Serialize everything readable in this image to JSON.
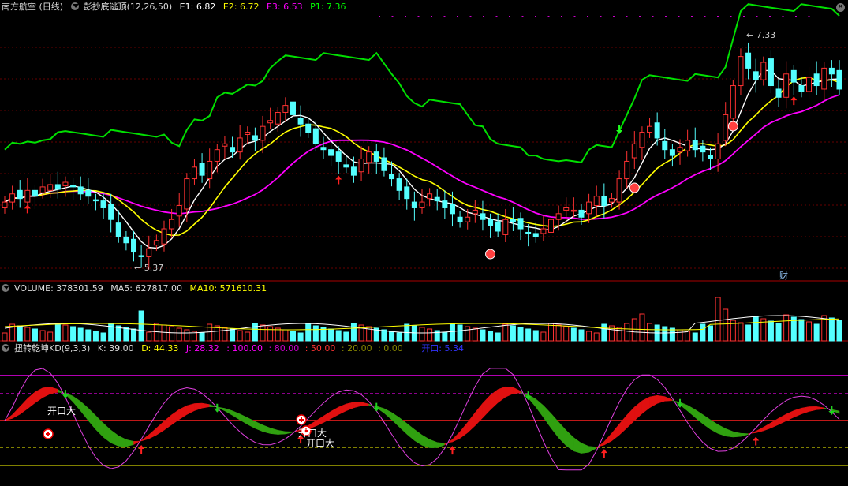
{
  "header": {
    "stock": "南方航空 (日线)",
    "indicator": "彭抄底逃顶(12,26,50)",
    "e1": "E1: 6.82",
    "e2": "E2: 6.72",
    "e3": "E3: 6.53",
    "p1": "P1: 7.36",
    "colors": {
      "e1": "#ffffff",
      "e2": "#ffff00",
      "e3": "#ff00ff",
      "p1": "#00ff00"
    }
  },
  "volume_header": {
    "volume": "VOLUME: 378301.59",
    "ma5": "MA5: 627817.00",
    "ma10": "MA10: 571610.31"
  },
  "kd_header": {
    "name": "扭转乾坤KD(9,3,3)",
    "k": "K: 39.00",
    "d": "D: 44.33",
    "j": "J: 28.32",
    "l100": ": 100.00",
    "l80": ": 80.00",
    "l50": ": 50.00",
    "l20": ": 20.00",
    "l0": ": 0.00",
    "kaikou": "开口: 5.34"
  },
  "annotations": {
    "high_label": "← 7.33",
    "low_label": "← 5.37",
    "cai": "财",
    "kaikou_labels": [
      "开口大",
      "开口大",
      "开口大"
    ]
  },
  "chart_data": [
    {
      "type": "candlestick",
      "panel": "price",
      "y_range": [
        5.2,
        7.45
      ],
      "high": 7.33,
      "low": 5.37,
      "close": [
        5.85,
        5.92,
        5.88,
        5.95,
        5.9,
        5.98,
        6.0,
        5.96,
        6.02,
        5.98,
        5.92,
        5.9,
        5.86,
        5.8,
        5.7,
        5.55,
        5.5,
        5.42,
        5.38,
        5.45,
        5.52,
        5.62,
        5.7,
        5.82,
        6.05,
        6.15,
        6.08,
        6.2,
        6.3,
        6.35,
        6.28,
        6.4,
        6.45,
        6.38,
        6.5,
        6.55,
        6.62,
        6.68,
        6.6,
        6.52,
        6.45,
        6.35,
        6.3,
        6.25,
        6.2,
        6.15,
        6.08,
        6.22,
        6.28,
        6.2,
        6.12,
        6.05,
        5.95,
        5.88,
        5.8,
        5.85,
        5.92,
        5.86,
        5.8,
        5.75,
        5.68,
        5.72,
        5.78,
        5.7,
        5.65,
        5.6,
        5.7,
        5.68,
        5.62,
        5.58,
        5.55,
        5.62,
        5.7,
        5.75,
        5.8,
        5.78,
        5.72,
        5.85,
        5.9,
        5.82,
        5.88,
        6.05,
        6.2,
        6.35,
        6.45,
        6.5,
        6.4,
        6.3,
        6.25,
        6.32,
        6.38,
        6.3,
        6.28,
        6.22,
        6.35,
        6.6,
        6.85,
        7.1,
        7.0,
        6.9,
        7.05,
        6.85,
        6.75,
        6.95,
        6.88,
        6.8,
        6.92,
        6.85,
        7.0,
        6.95,
        6.82
      ]
    },
    {
      "type": "bar",
      "panel": "volume",
      "series": [
        {
          "name": "VOLUME"
        },
        {
          "name": "MA5"
        },
        {
          "name": "MA10"
        }
      ]
    },
    {
      "type": "line",
      "panel": "kd",
      "levels": [
        100,
        80,
        50,
        20,
        0
      ],
      "series": [
        {
          "name": "K"
        },
        {
          "name": "D"
        },
        {
          "name": "J"
        }
      ]
    }
  ]
}
